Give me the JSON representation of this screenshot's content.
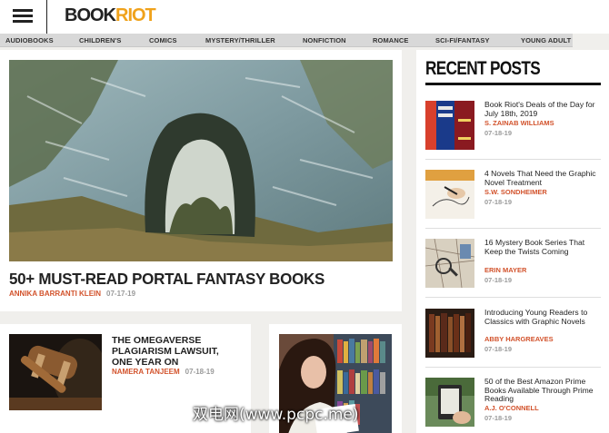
{
  "header": {
    "logo_main": "BOOK",
    "logo_accent": "RIOT",
    "logo_accent_color": "#f0a21b"
  },
  "nav": {
    "items": [
      "AUDIOBOOKS",
      "CHILDREN'S",
      "COMICS",
      "MYSTERY/THRILLER",
      "NONFICTION",
      "ROMANCE",
      "SCI-FI/FANTASY",
      "YOUNG ADULT"
    ]
  },
  "featured": {
    "title": "50+ MUST-READ PORTAL FANTASY BOOKS",
    "author": "ANNIKA BARRANTI KLEIN",
    "date": "07-17-19"
  },
  "secondary": {
    "title": "THE OMEGAVERSE PLAGIARISM LAWSUIT, ONE YEAR ON",
    "author": "NAMERA TANJEEM",
    "date": "07-18-19"
  },
  "sidebar": {
    "heading": "RECENT POSTS",
    "posts": [
      {
        "title": "Book Riot's Deals of the Day for July 18th, 2019",
        "author": "S. ZAINAB WILLIAMS",
        "date": "07-18-19"
      },
      {
        "title": "4 Novels That Need the Graphic Novel Treatment",
        "author": "S.W. SONDHEIMER",
        "date": "07-18-19"
      },
      {
        "title": "16 Mystery Book Series That Keep the Twists Coming",
        "author": "ERIN MAYER",
        "date": "07-18-19"
      },
      {
        "title": "Introducing Young Readers to Classics with Graphic Novels",
        "author": "ABBY HARGREAVES",
        "date": "07-18-19"
      },
      {
        "title": "50 of the Best Amazon Prime Books Available Through Prime Reading",
        "author": "A.J. O'CONNELL",
        "date": "07-18-19"
      }
    ]
  },
  "watermark": "双电网(www.pcpc.me)",
  "colors": {
    "author": "#d2522b",
    "date": "#9a9a9a",
    "nav_bg": "#d8d8d8",
    "page_bg": "#f0efec"
  }
}
